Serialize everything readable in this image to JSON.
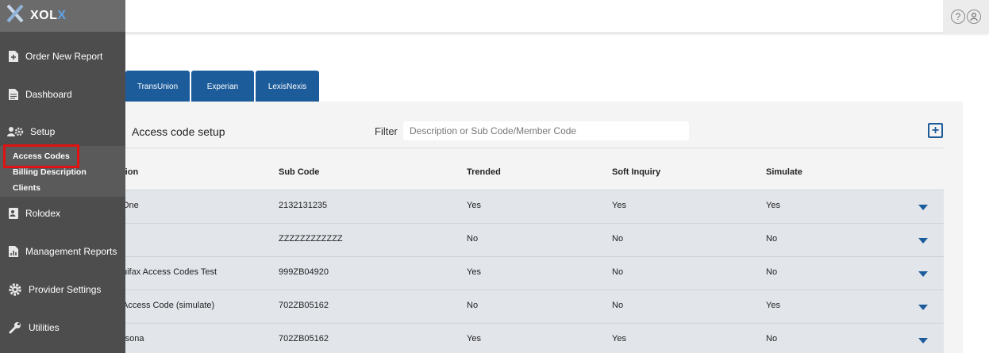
{
  "header": {
    "help_icon": "help-icon",
    "user_icon": "user-icon"
  },
  "logo": {
    "text_main": "XOL",
    "text_accent": "X"
  },
  "sidebar": {
    "items": [
      {
        "label": "Order New Report",
        "icon": "add-document-icon"
      },
      {
        "label": "Dashboard",
        "icon": "document-icon"
      },
      {
        "label": "Setup",
        "icon": "users-gear-icon"
      },
      {
        "label": "Rolodex",
        "icon": "contact-card-icon"
      },
      {
        "label": "Management Reports",
        "icon": "report-chart-icon"
      },
      {
        "label": "Provider Settings",
        "icon": "gear-icon"
      },
      {
        "label": "Utilities",
        "icon": "wrench-icon"
      }
    ],
    "setup_submenu": [
      {
        "label": "Access Codes"
      },
      {
        "label": "Billing Description"
      },
      {
        "label": "Clients"
      }
    ]
  },
  "tabs": [
    {
      "label": "TransUnion"
    },
    {
      "label": "Experian"
    },
    {
      "label": "LexisNexis"
    }
  ],
  "panel": {
    "title": "Access code setup",
    "filter_label": "Filter",
    "filter_placeholder": "Description or Sub Code/Member Code",
    "add_label": "+"
  },
  "table": {
    "headers": [
      "tion",
      "Sub Code",
      "Trended",
      "Soft Inquiry",
      "Simulate"
    ],
    "rows": [
      [
        "One",
        "2132131235",
        "Yes",
        "Yes",
        "Yes"
      ],
      [
        "",
        "ZZZZZZZZZZZZ",
        "No",
        "No",
        "No"
      ],
      [
        "uifax Access Codes Test",
        "999ZB04920",
        "Yes",
        "No",
        "No"
      ],
      [
        "Access Code (simulate)",
        "702ZB05162",
        "No",
        "No",
        "Yes"
      ],
      [
        "rsona",
        "702ZB05162",
        "Yes",
        "Yes",
        "No"
      ]
    ]
  },
  "colors": {
    "accent": "#1d5c9b",
    "sidebar": "#4d4d4d",
    "highlight": "#e01212"
  }
}
